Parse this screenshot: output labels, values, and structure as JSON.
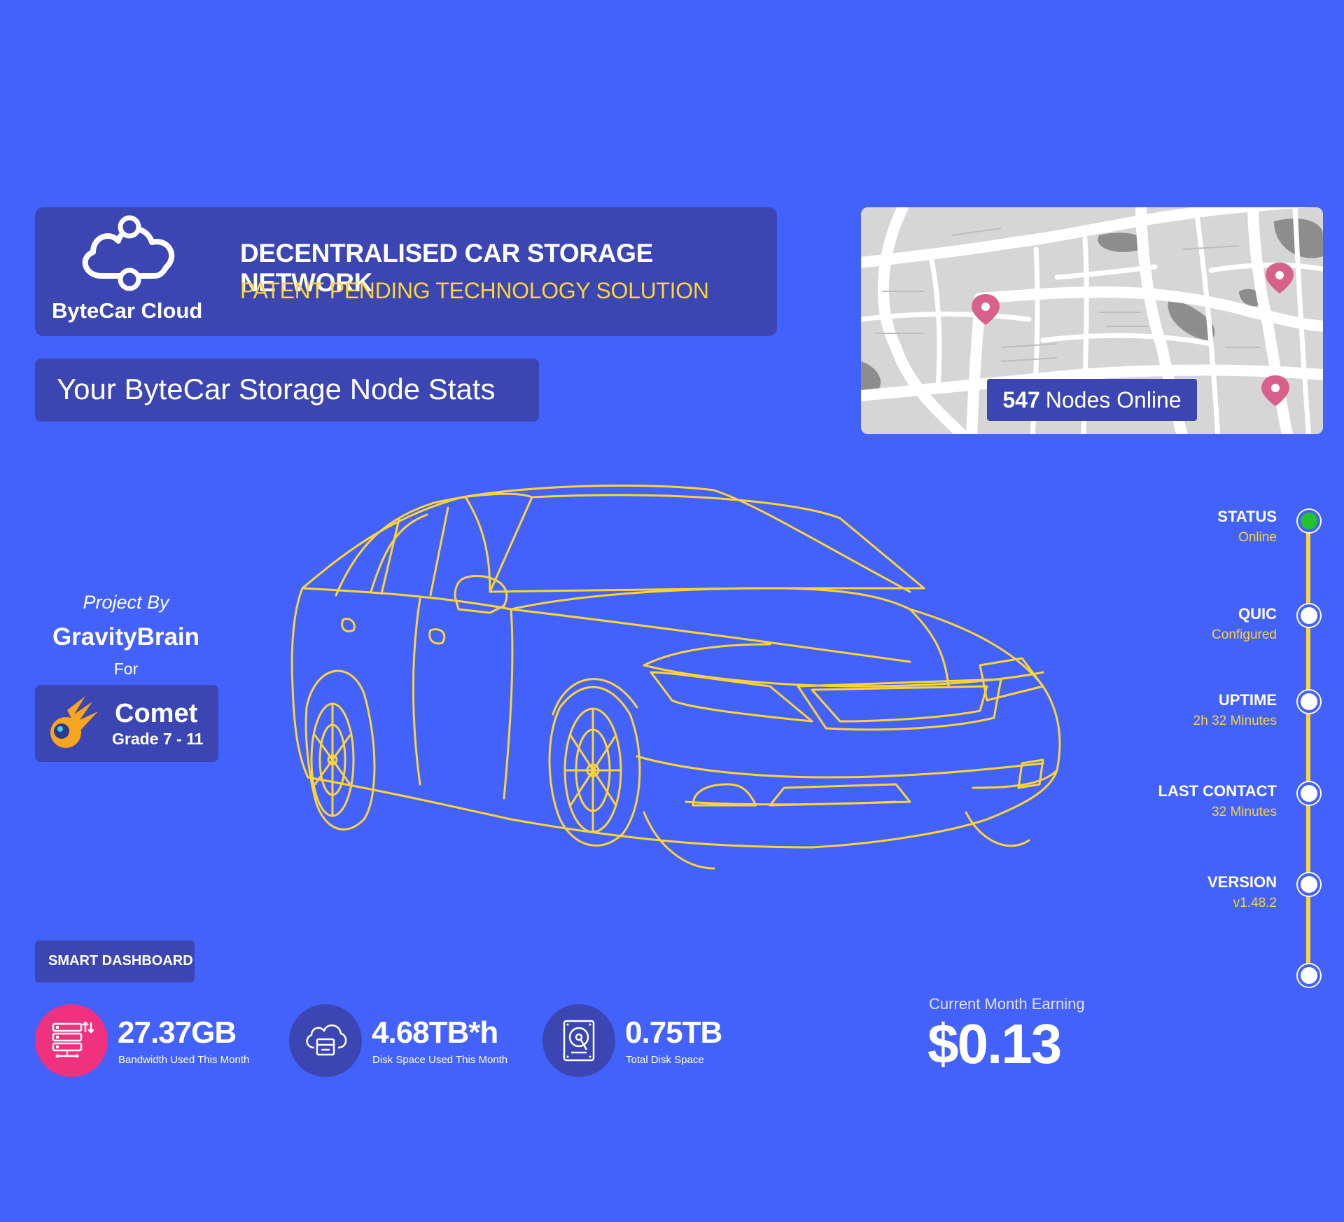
{
  "header": {
    "brand_name": "ByteCar Cloud",
    "title": "DECENTRALISED CAR STORAGE NETWORK",
    "subtitle": "PATENT PENDING TECHNOLOGY SOLUTION",
    "logo_icon": "cloud-network-icon"
  },
  "page_title": "Your ByteCar Storage Node Stats",
  "map": {
    "nodes_count": "547",
    "nodes_label": "Nodes Online",
    "pin_icon": "map-pin-icon",
    "pin_color": "#d8618b"
  },
  "project": {
    "by_label": "Project By",
    "author": "GravityBrain",
    "for_label": "For",
    "program_name": "Comet",
    "program_grade": "Grade 7 - 11",
    "program_icon": "comet-icon"
  },
  "status": [
    {
      "label": "STATUS",
      "value": "Online",
      "active": true
    },
    {
      "label": "QUIC",
      "value": "Configured"
    },
    {
      "label": "UPTIME",
      "value": "2h 32 Minutes"
    },
    {
      "label": "LAST CONTACT",
      "value": "32 Minutes"
    },
    {
      "label": "VERSION",
      "value": "v1.48.2"
    }
  ],
  "dashboard": {
    "button_label": "SMART DASHBOARD",
    "stats": [
      {
        "value": "27.37GB",
        "caption": "Bandwidth Used This Month",
        "icon": "server-transfer-icon",
        "color": "#f0317d"
      },
      {
        "value": "4.68TB*h",
        "caption": "Disk Space Used This Month",
        "icon": "cloud-storage-icon",
        "color": "#3b46b2"
      },
      {
        "value": "0.75TB",
        "caption": "Total Disk Space",
        "icon": "hard-drive-icon",
        "color": "#3b46b2"
      }
    ]
  },
  "earning": {
    "label": "Current Month Earning",
    "value": "$0.13"
  },
  "colors": {
    "background": "#4361fb",
    "panel": "#3b46b2",
    "accent_yellow": "#fcd535",
    "status_online": "#22c32b"
  }
}
